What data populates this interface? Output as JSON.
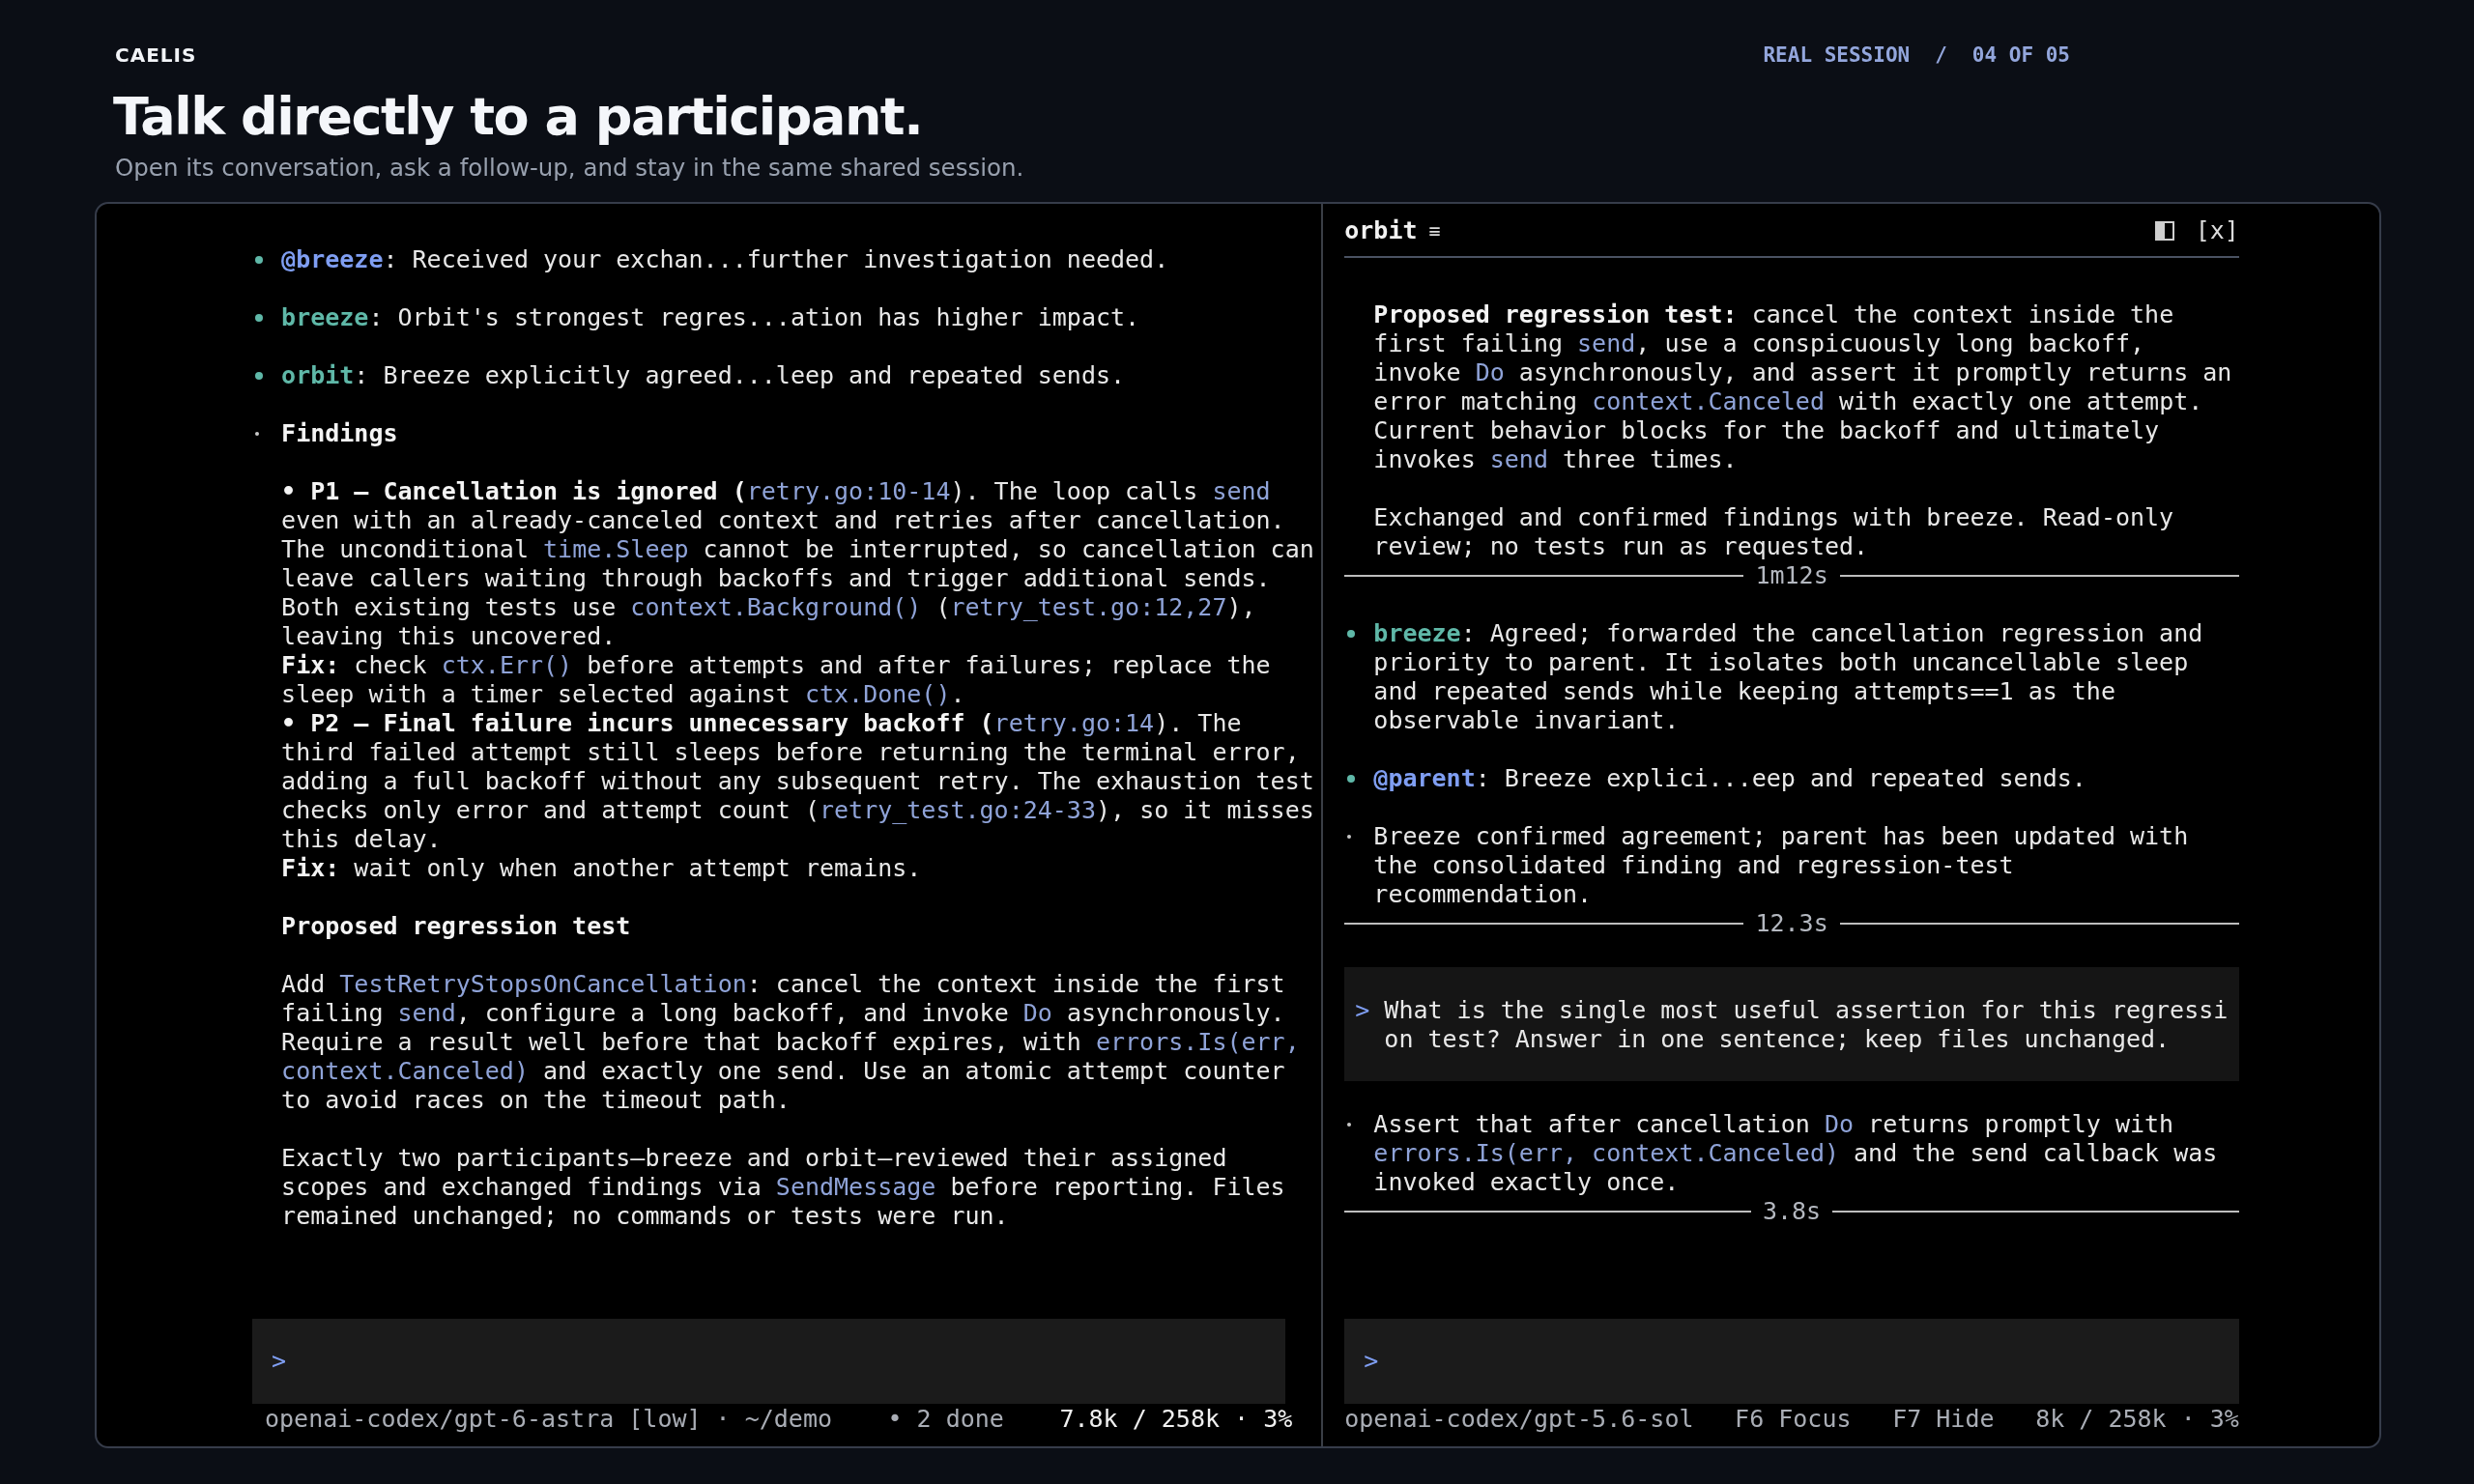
{
  "header": {
    "brand": "CAELIS",
    "session": "REAL SESSION",
    "separator": "/",
    "step": "04 OF 05",
    "title": "Talk directly to a participant.",
    "subtitle": "Open its conversation, ask a follow-up, and stay in the same shared session."
  },
  "panes": [
    {
      "entries": [
        {
          "kind": "message",
          "author": {
            "kind": "mention",
            "name": "@breeze"
          },
          "text": ": Received your exchan...further investigation needed."
        },
        {
          "kind": "message",
          "author": {
            "kind": "agent",
            "name": "breeze"
          },
          "text": ": Orbit's strongest regres...ation has higher impact."
        },
        {
          "kind": "message",
          "author": {
            "kind": "agent",
            "name": "orbit"
          },
          "text": ": Breeze explicitly agreed...leep and repeated sends."
        },
        {
          "kind": "note",
          "groups": [
            [
              {
                "kind": "heading",
                "text": "Findings"
              }
            ],
            [
              {
                "kind": "para",
                "runs": [
                  {
                    "kind": "bold",
                    "text": "• P1 — Cancellation is ignored ("
                  },
                  {
                    "kind": "code",
                    "text": "retry.go:10-14"
                  },
                  {
                    "kind": "plain",
                    "text": "). The loop calls "
                  },
                  {
                    "kind": "code",
                    "text": "send"
                  },
                  {
                    "kind": "plain",
                    "text": " even with an already-canceled context and retries after cancellation. The unconditional "
                  },
                  {
                    "kind": "code",
                    "text": "time.Sleep"
                  },
                  {
                    "kind": "plain",
                    "text": " cannot be interrupted, so cancellation can leave callers waiting through backoffs and trigger additional sends. Both existing tests use "
                  },
                  {
                    "kind": "code",
                    "text": "context.Background()"
                  },
                  {
                    "kind": "plain",
                    "text": " ("
                  },
                  {
                    "kind": "code",
                    "text": "retry_test.go:12,27"
                  },
                  {
                    "kind": "plain",
                    "text": "), leaving this uncovered."
                  }
                ]
              },
              {
                "kind": "para",
                "runs": [
                  {
                    "kind": "bold",
                    "text": "Fix:"
                  },
                  {
                    "kind": "plain",
                    "text": " check "
                  },
                  {
                    "kind": "code",
                    "text": "ctx.Err()"
                  },
                  {
                    "kind": "plain",
                    "text": " before attempts and after failures; replace the sleep with a timer selected against "
                  },
                  {
                    "kind": "code",
                    "text": "ctx.Done()"
                  },
                  {
                    "kind": "plain",
                    "text": "."
                  }
                ]
              },
              {
                "kind": "para",
                "runs": [
                  {
                    "kind": "bold",
                    "text": "• P2 — Final failure incurs unnecessary backoff ("
                  },
                  {
                    "kind": "code",
                    "text": "retry.go:14"
                  },
                  {
                    "kind": "plain",
                    "text": "). The third failed attempt still sleeps before returning the terminal error, adding a full backoff without any subsequent retry. The exhaustion test checks only error and attempt count ("
                  },
                  {
                    "kind": "code",
                    "text": "retry_test.go:24-33"
                  },
                  {
                    "kind": "plain",
                    "text": "), so it misses this delay."
                  }
                ]
              },
              {
                "kind": "para",
                "runs": [
                  {
                    "kind": "bold",
                    "text": "Fix:"
                  },
                  {
                    "kind": "plain",
                    "text": " wait only when another attempt remains."
                  }
                ]
              }
            ],
            [
              {
                "kind": "heading",
                "text": "Proposed regression test"
              }
            ],
            [
              {
                "kind": "para",
                "runs": [
                  {
                    "kind": "plain",
                    "text": "Add "
                  },
                  {
                    "kind": "code",
                    "text": "TestRetryStopsOnCancellation"
                  },
                  {
                    "kind": "plain",
                    "text": ": cancel the context inside the first failing "
                  },
                  {
                    "kind": "code",
                    "text": "send"
                  },
                  {
                    "kind": "plain",
                    "text": ", configure a long backoff, and invoke "
                  },
                  {
                    "kind": "code",
                    "text": "Do"
                  },
                  {
                    "kind": "plain",
                    "text": " asynchronously. Require a result well before that backoff expires, with "
                  },
                  {
                    "kind": "code",
                    "text": "errors.Is(err, context.Canceled)"
                  },
                  {
                    "kind": "plain",
                    "text": " and exactly one send. Use an atomic attempt counter to avoid races on the timeout path."
                  }
                ]
              }
            ],
            [
              {
                "kind": "para",
                "runs": [
                  {
                    "kind": "plain",
                    "text": "Exactly two participants—breeze and orbit—reviewed their assigned scopes and exchanged findings via "
                  },
                  {
                    "kind": "code",
                    "text": "SendMessage"
                  },
                  {
                    "kind": "plain",
                    "text": " before reporting. Files remained unchanged; no commands or tests were run."
                  }
                ]
              }
            ]
          ]
        }
      ],
      "input": {
        "prompt": ">"
      },
      "status": [
        {
          "text": "openai-codex/gpt-6-astra [low] · ~/demo",
          "bright": false
        },
        {
          "text": "• 2 done",
          "bright": false
        },
        {
          "text": "7.8k / 258k · 3%",
          "bright": true
        }
      ]
    },
    {
      "header": {
        "title": "orbit",
        "menu": "≡",
        "close": "[x]"
      },
      "entries": [
        {
          "kind": "text",
          "groups": [
            [
              {
                "kind": "para",
                "runs": [
                  {
                    "kind": "bold",
                    "text": "Proposed regression test:"
                  },
                  {
                    "kind": "plain",
                    "text": " cancel the context inside the first failing "
                  },
                  {
                    "kind": "code",
                    "text": "send"
                  },
                  {
                    "kind": "plain",
                    "text": ", use a conspicuously long backoff, invoke "
                  },
                  {
                    "kind": "code",
                    "text": "Do"
                  },
                  {
                    "kind": "plain",
                    "text": " asynchronously, and assert it promptly returns an error matching "
                  },
                  {
                    "kind": "code",
                    "text": "context.Canceled"
                  },
                  {
                    "kind": "plain",
                    "text": " with exactly one attempt. Current behavior blocks for the backoff and ultimately invokes "
                  },
                  {
                    "kind": "code",
                    "text": "send"
                  },
                  {
                    "kind": "plain",
                    "text": " three times."
                  }
                ]
              }
            ],
            [
              {
                "kind": "para",
                "runs": [
                  {
                    "kind": "plain",
                    "text": "Exchanged and confirmed findings with breeze. Read-only review; no tests run as requested."
                  }
                ]
              }
            ]
          ]
        },
        {
          "kind": "divider",
          "label": "1m12s"
        },
        {
          "kind": "message",
          "author": {
            "kind": "agent",
            "name": "breeze"
          },
          "text": ": Agreed; forwarded the cancellation regression and priority to parent. It isolates both uncancellable sleep and repeated sends while keeping attempts==1 as the observable invariant."
        },
        {
          "kind": "message",
          "author": {
            "kind": "mention",
            "name": "@parent"
          },
          "text": ": Breeze explici...eep and repeated sends."
        },
        {
          "kind": "note",
          "groups": [
            [
              {
                "kind": "para",
                "runs": [
                  {
                    "kind": "plain",
                    "text": "Breeze confirmed agreement; parent has been updated with the consolidated finding and regression-test recommendation."
                  }
                ]
              }
            ]
          ]
        },
        {
          "kind": "divider",
          "label": "12.3s"
        },
        {
          "kind": "prompt",
          "prompt": ">",
          "text": "What is the single most useful assertion for this regression test? Answer in one sentence; keep files unchanged."
        },
        {
          "kind": "note",
          "groups": [
            [
              {
                "kind": "para",
                "runs": [
                  {
                    "kind": "plain",
                    "text": "Assert that after cancellation "
                  },
                  {
                    "kind": "code",
                    "text": "Do"
                  },
                  {
                    "kind": "plain",
                    "text": " returns promptly with "
                  },
                  {
                    "kind": "code",
                    "text": "errors.Is(err, context.Canceled)"
                  },
                  {
                    "kind": "plain",
                    "text": " and the send callback was invoked exactly once."
                  }
                ]
              }
            ]
          ]
        },
        {
          "kind": "divider",
          "label": "3.8s"
        }
      ],
      "input": {
        "prompt": ">"
      },
      "status": [
        {
          "text": "openai-codex/gpt-5.6-sol",
          "bright": false
        },
        {
          "text": "F6 Focus",
          "bright": false
        },
        {
          "text": "F7 Hide",
          "bright": false
        },
        {
          "text": "8k / 258k · 3%",
          "bright": false
        }
      ]
    }
  ]
}
